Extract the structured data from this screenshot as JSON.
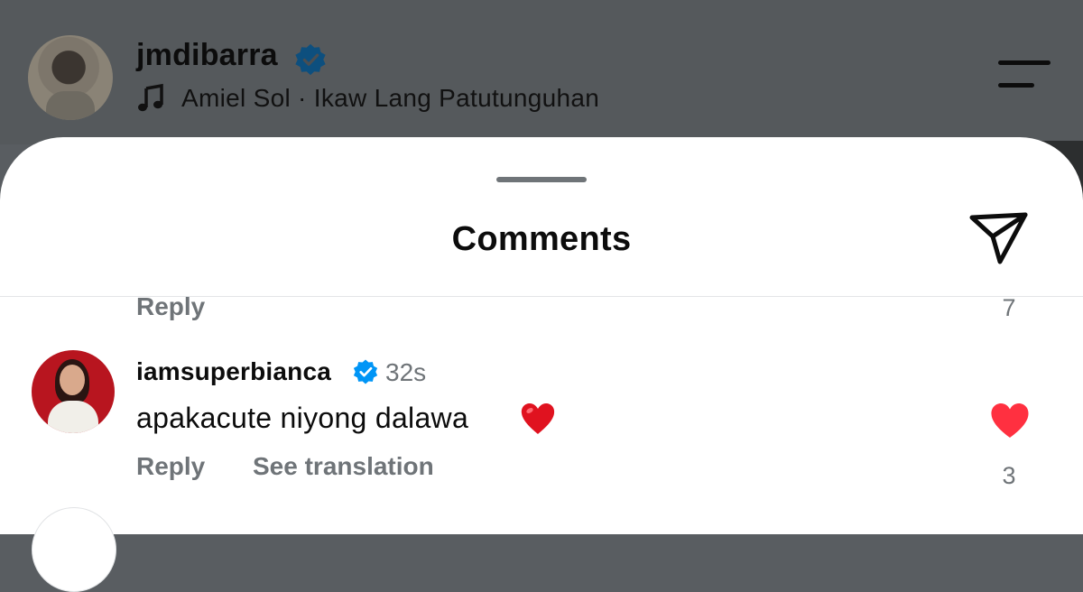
{
  "post_header": {
    "username": "jmdibarra",
    "audio": "Amiel Sol · Ikaw Lang Patutunguhan",
    "verified_icon": "verified-badge-icon",
    "music_icon": "music-note-icon",
    "menu_icon": "menu-icon"
  },
  "comments_sheet": {
    "title": "Comments",
    "share_icon": "send-icon",
    "previous_comment": {
      "reply_label": "Reply",
      "like_count": "7"
    },
    "comment": {
      "username": "iamsuperbianca",
      "time": "32s",
      "text": "apakacute niyong dalawa",
      "emoji": "red-heart-emoji",
      "reply_label": "Reply",
      "translate_label": "See translation",
      "like_count": "3",
      "liked": true
    }
  },
  "colors": {
    "verified_blue": "#0095f6",
    "like_red": "#ff3040",
    "secondary_text": "#6f7478"
  }
}
